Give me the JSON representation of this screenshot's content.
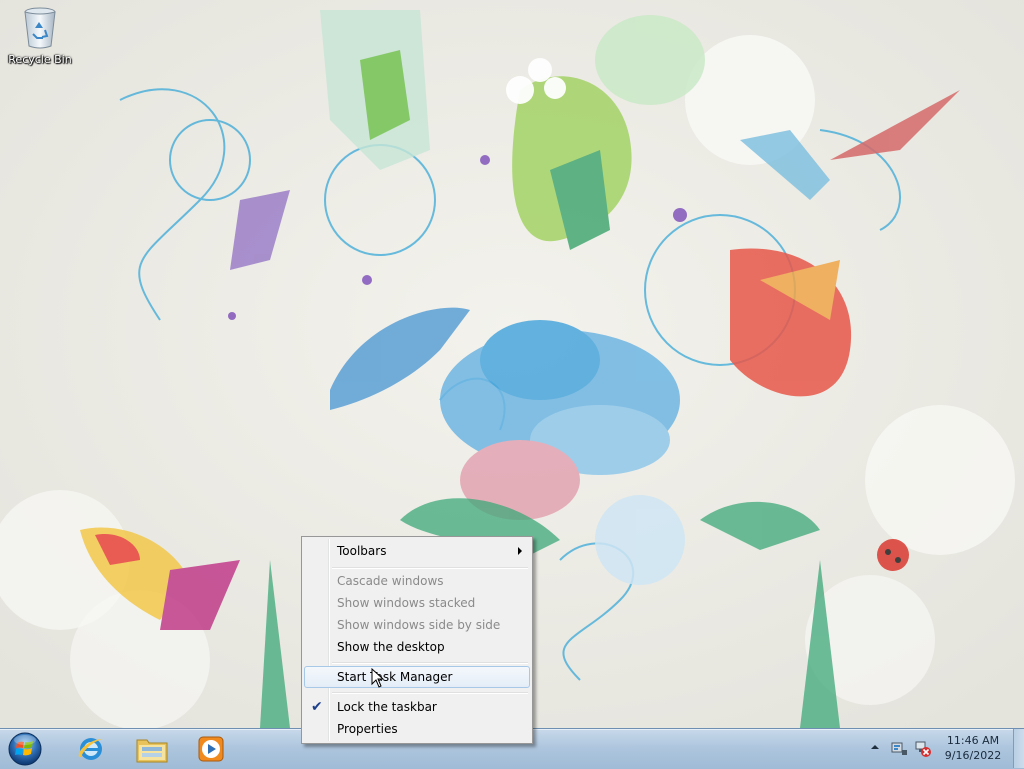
{
  "desktop": {
    "icons": [
      {
        "label": "Recycle Bin",
        "icon": "recycle-bin-icon"
      }
    ]
  },
  "taskbar": {
    "start_icon": "windows-orb-icon",
    "pinned": [
      {
        "icon": "internet-explorer-icon"
      },
      {
        "icon": "windows-explorer-icon"
      },
      {
        "icon": "windows-media-player-icon"
      }
    ],
    "tray": {
      "icons": [
        "show-hidden-icons-arrow",
        "action-center-flag-icon",
        "network-disconnected-icon"
      ],
      "time": "11:46 AM",
      "date": "9/16/2022"
    }
  },
  "context_menu": {
    "items": [
      {
        "label": "Toolbars",
        "submenu": true,
        "enabled": true
      },
      {
        "label": "Cascade windows",
        "enabled": false
      },
      {
        "label": "Show windows stacked",
        "enabled": false
      },
      {
        "label": "Show windows side by side",
        "enabled": false
      },
      {
        "label": "Show the desktop",
        "enabled": true
      },
      {
        "label": "Start Task Manager",
        "enabled": true,
        "highlighted": true
      },
      {
        "label": "Lock the taskbar",
        "enabled": true,
        "checked": true
      },
      {
        "label": "Properties",
        "enabled": true
      }
    ],
    "check_glyph": "✔"
  },
  "colors": {
    "taskbar": "#aec6de",
    "menu_background": "#f0f0f0",
    "menu_highlight_border": "#a8c8e8",
    "disabled_text": "#8a8a8a"
  }
}
